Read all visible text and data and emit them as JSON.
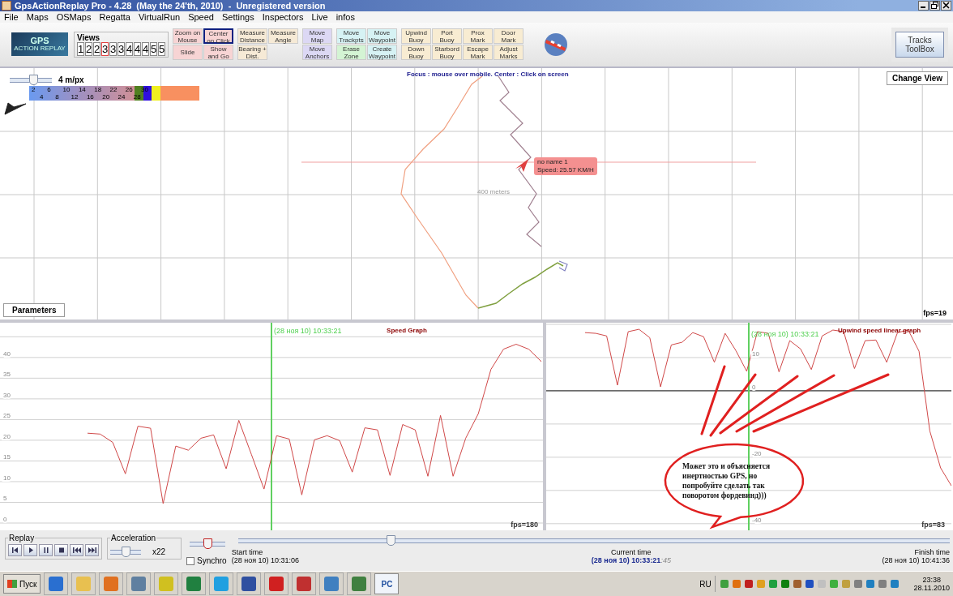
{
  "window": {
    "title": "GpsActionReplay Pro - 4.28  (May the 24'th, 2010)  -  Unregistered version"
  },
  "menu": [
    "File",
    "Maps",
    "OSMaps",
    "Regatta",
    "VirtualRun",
    "Speed",
    "Settings",
    "Inspectors",
    "Live",
    "infos"
  ],
  "logo": {
    "title": "GPS",
    "subtitle": "ACTION REPLAY"
  },
  "views": {
    "label": "Views",
    "items": [
      {
        "label": "1",
        "selected": false
      },
      {
        "label": "2",
        "selected": false
      },
      {
        "label": "2",
        "selected": false
      },
      {
        "label": "3",
        "selected": true
      },
      {
        "label": "3",
        "selected": false
      },
      {
        "label": "3",
        "selected": false
      },
      {
        "label": "4",
        "selected": false
      },
      {
        "label": "4",
        "selected": false
      },
      {
        "label": "4",
        "selected": false
      },
      {
        "label": "5",
        "selected": false
      },
      {
        "label": "5",
        "selected": false
      }
    ]
  },
  "tool_groups": [
    {
      "buttons": [
        {
          "label": "Zoom on Mouse",
          "color": "#f7d4d4",
          "selected": false
        },
        {
          "label": "Center on Click",
          "color": "#f7d4d4",
          "selected": true
        },
        {
          "label": "Slide",
          "color": "#f7d4d4",
          "selected": false
        },
        {
          "label": "Show and Go",
          "color": "#f7d4d4",
          "selected": false
        }
      ]
    },
    {
      "buttons": [
        {
          "label": "Measure Distance",
          "color": "#f6ead6",
          "selected": false
        },
        {
          "label": "Measure Angle",
          "color": "#f6ead6",
          "selected": false
        },
        {
          "label": "Bearing + Dist.",
          "color": "#f6ead6",
          "selected": false
        }
      ]
    },
    {
      "buttons": [
        {
          "label": "Move Map",
          "color": "#dcd8f4",
          "selected": false
        },
        {
          "label": "Move Anchors",
          "color": "#dcd8f4",
          "selected": false
        }
      ]
    },
    {
      "buttons": [
        {
          "label": "Move Trackpts",
          "color": "#d6f2f4",
          "selected": false
        },
        {
          "label": "Move Waypoint",
          "color": "#d6f2f4",
          "selected": false
        },
        {
          "label": "Erase Zone",
          "color": "#d4f4d4",
          "selected": false
        },
        {
          "label": "Create Waypoint",
          "color": "#d6f2f4",
          "selected": false
        }
      ]
    },
    {
      "buttons": [
        {
          "label": "Upwind Buoy",
          "color": "#f8ecd2",
          "selected": false
        },
        {
          "label": "Port Buoy",
          "color": "#f8ecd2",
          "selected": false
        },
        {
          "label": "Prox Mark",
          "color": "#f8ecd2",
          "selected": false
        },
        {
          "label": "Door Mark",
          "color": "#f8ecd2",
          "selected": false
        },
        {
          "label": "Down Buoy",
          "color": "#f8ecd2",
          "selected": false
        },
        {
          "label": "Starbord Buoy",
          "color": "#f8ecd2",
          "selected": false
        },
        {
          "label": "Escape Mark",
          "color": "#f8ecd2",
          "selected": false
        },
        {
          "label": "Adjust Marks",
          "color": "#f8ecd2",
          "selected": false
        }
      ]
    }
  ],
  "toolbox_button": "Tracks ToolBox",
  "map": {
    "scale": {
      "level": 0.55,
      "label": "4 m/px"
    },
    "legend": {
      "top_labels": [
        "2",
        "6",
        "10",
        "14",
        "18",
        "22",
        "26",
        "30"
      ],
      "bottom_labels": [
        "4",
        "8",
        "12",
        "16",
        "20",
        "24",
        "28"
      ]
    },
    "focus_hint": "Focus : mouse over mobile. Center : Click on screen",
    "change_view": "Change View",
    "distance_label": "400 meters",
    "mobile": {
      "name": "no name 1",
      "speed": "Speed: 25.57 KM/H"
    },
    "parameters": "Parameters",
    "fps": "fps=19"
  },
  "speed_graph": {
    "cursor_label": "(28 ноя 10) 10:33:21",
    "fps": "fps=180",
    "chart_data": {
      "type": "line",
      "title": "Speed Graph",
      "ylim": [
        0,
        48
      ],
      "yticks": [
        0,
        5,
        10,
        15,
        20,
        25,
        30,
        35,
        40
      ],
      "grid": true,
      "series": [
        {
          "color": "#d04848",
          "values": [
            21.7,
            21.5,
            19.5,
            11.9,
            23.4,
            22.9,
            4.7,
            18.6,
            17.6,
            20.5,
            21.3,
            13.1,
            24.8,
            16.6,
            8.2,
            21.1,
            20.3,
            6.8,
            20.1,
            21.1,
            19.9,
            12.3,
            23,
            22.5,
            11.5,
            23.8,
            22.5,
            11.3,
            26,
            11.3,
            20.5,
            26.4,
            37.1,
            42,
            43.2,
            42,
            39
          ]
        }
      ]
    }
  },
  "upwind_graph": {
    "cursor_label": "(28 ноя 10) 10:33:21",
    "fps": "fps=83",
    "chart_data": {
      "type": "line",
      "title": "Upwind speed linear graph",
      "ylim": [
        -42,
        20
      ],
      "yticks": [
        10,
        0,
        -20,
        -40
      ],
      "grid": true,
      "series": [
        {
          "color": "#d04848",
          "values": [
            17.5,
            17.3,
            16.5,
            1.7,
            17.8,
            18.5,
            16,
            1.2,
            13.8,
            14.6,
            17.5,
            16.3,
            8.6,
            17.3,
            12.1,
            5.9,
            17.8,
            17.3,
            5.7,
            15.1,
            12.6,
            6.4,
            16.5,
            18.3,
            17.8,
            6.7,
            15.1,
            15.3,
            8.6,
            17.5,
            18.3,
            11.9,
            -12.1,
            -23.2,
            -28.6
          ]
        }
      ]
    },
    "annotation": "Может это и объясняется инертностью GPS, но попробуйте сделать так поворотом фордевинд)))"
  },
  "replay": {
    "label": "Replay"
  },
  "acceleration": {
    "label": "Acceleration",
    "level": 0.5,
    "value": "x22"
  },
  "mini_slider": {
    "level": 0.5
  },
  "synchro": {
    "label": "Synchro",
    "checked": false
  },
  "timeline": {
    "level": 0.214
  },
  "times": {
    "start_label": "Start time",
    "start": "(28 ноя 10) 10:31:06",
    "current_label": "Current time",
    "current": "(28 ноя 10) 10:33:21",
    "current_fraction": ":45",
    "finish_label": "Finish time",
    "finish": "(28 ноя 10) 10:41:36"
  },
  "taskbar": {
    "start": "Пуск",
    "pc_label": "PC",
    "language": "RU",
    "time": "23:38",
    "date": "28.11.2010"
  }
}
